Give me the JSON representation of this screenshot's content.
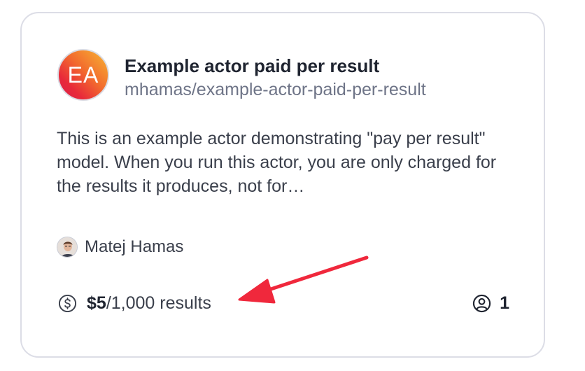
{
  "actor": {
    "initials": "EA",
    "title": "Example actor paid per result",
    "slug": "mhamas/example-actor-paid-per-result",
    "description": "This is an example actor demonstrating \"pay per result\" model. When you run this actor, you are only charged for the results it produces, not for…"
  },
  "author": {
    "name": "Matej Hamas"
  },
  "pricing": {
    "amount": "$5",
    "unit": "/1,000 results"
  },
  "stats": {
    "users": "1"
  },
  "icons": {
    "pricing": "dollar-circle-icon",
    "users": "user-circle-icon",
    "annotation": "red-arrow-icon"
  },
  "colors": {
    "annotation_arrow": "#f0283c",
    "card_border": "#dcdde6"
  }
}
